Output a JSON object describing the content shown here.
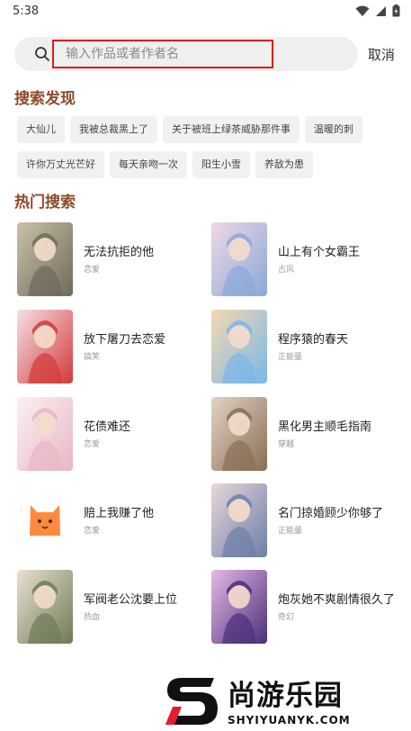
{
  "status_bar": {
    "time": "5:38"
  },
  "search": {
    "placeholder": "输入作品或者作者名",
    "cancel_label": "取消"
  },
  "discover": {
    "title": "搜索发现",
    "rows": [
      [
        "大仙儿",
        "我被总裁黑上了",
        "关于被班上绿茶威胁那件事",
        "温暖的刺"
      ],
      [
        "许你万丈光芒好",
        "每天亲吻一次",
        "阳生小雪",
        "养敌为患"
      ]
    ]
  },
  "hot": {
    "title": "热门搜索",
    "items": [
      {
        "title": "无法抗拒的他",
        "genre": "恋爱",
        "colors": [
          "#6e6a5a",
          "#c9c2a8"
        ]
      },
      {
        "title": "山上有个女霸王",
        "genre": "古风",
        "colors": [
          "#8aa9d8",
          "#f0d7e4"
        ]
      },
      {
        "title": "放下屠刀去恋爱",
        "genre": "搞笑",
        "colors": [
          "#d33a3a",
          "#f5e0e6"
        ]
      },
      {
        "title": "程序猿的春天",
        "genre": "正能量",
        "colors": [
          "#7ab7e8",
          "#f3d9b0"
        ]
      },
      {
        "title": "花债难还",
        "genre": "恋爱",
        "colors": [
          "#e9b7c4",
          "#faf0f2"
        ]
      },
      {
        "title": "黑化男主顺毛指南",
        "genre": "穿越",
        "colors": [
          "#8a6f55",
          "#e2d3c5"
        ]
      },
      {
        "title": "赔上我赚了他",
        "genre": "恋爱",
        "colors": [
          "#ffffff",
          "#ffffff"
        ]
      },
      {
        "title": "名门掠婚顾少你够了",
        "genre": "正能量",
        "colors": [
          "#6c7fa8",
          "#e8d6da"
        ]
      },
      {
        "title": "军阀老公沈要上位",
        "genre": "热血",
        "colors": [
          "#6f7a58",
          "#e9e1cf"
        ]
      },
      {
        "title": "炮灰她不爽剧情很久了",
        "genre": "奇幻",
        "colors": [
          "#4a2f7a",
          "#e6b9e6"
        ]
      }
    ]
  },
  "watermark": {
    "text": "尚游乐园",
    "url": "SHYIYUANYK.COM"
  },
  "colors": {
    "accent": "#8b4a2b",
    "highlight": "#e01a1a"
  }
}
